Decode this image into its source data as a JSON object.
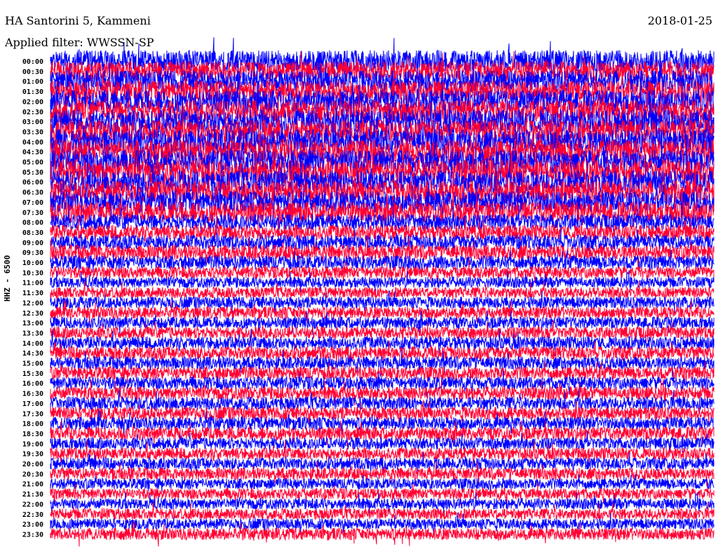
{
  "header": {
    "title": "HA Santorini 5, Kammeni",
    "filter": "Applied filter: WWSSN-SP",
    "date": "2018-01-25"
  },
  "chart_data": {
    "type": "line",
    "title": "HA Santorini 5, Kammeni",
    "subtitle": "Applied filter: WWSSN-SP",
    "ylabel": "HHZ - 6500",
    "date": "2018-01-25",
    "row_minutes": 30,
    "colors": [
      "#0000ff",
      "#ff0033"
    ],
    "rows": [
      "00:00",
      "00:30",
      "01:00",
      "01:30",
      "02:00",
      "02:30",
      "03:00",
      "03:30",
      "04:00",
      "04:30",
      "05:00",
      "05:30",
      "06:00",
      "06:30",
      "07:00",
      "07:30",
      "08:00",
      "08:30",
      "09:00",
      "09:30",
      "10:00",
      "10:30",
      "11:00",
      "11:30",
      "12:00",
      "12:30",
      "13:00",
      "13:30",
      "14:00",
      "14:30",
      "15:00",
      "15:30",
      "16:00",
      "16:30",
      "17:00",
      "17:30",
      "18:00",
      "18:30",
      "19:00",
      "19:30",
      "20:00",
      "20:30",
      "21:00",
      "21:30",
      "22:00",
      "22:30",
      "23:00",
      "23:30"
    ],
    "relative_amplitude": [
      2.2,
      2.0,
      2.2,
      2.2,
      2.3,
      2.3,
      2.4,
      2.4,
      2.5,
      2.5,
      2.4,
      2.4,
      2.3,
      2.3,
      2.2,
      2.1,
      1.6,
      1.5,
      1.5,
      1.5,
      1.4,
      1.2,
      1.1,
      1.1,
      1.2,
      1.2,
      1.2,
      1.2,
      1.3,
      1.3,
      1.3,
      1.3,
      1.3,
      1.3,
      1.3,
      1.3,
      1.3,
      1.3,
      1.2,
      1.2,
      1.2,
      1.2,
      1.1,
      1.1,
      1.1,
      1.1,
      1.1,
      1.2
    ]
  }
}
